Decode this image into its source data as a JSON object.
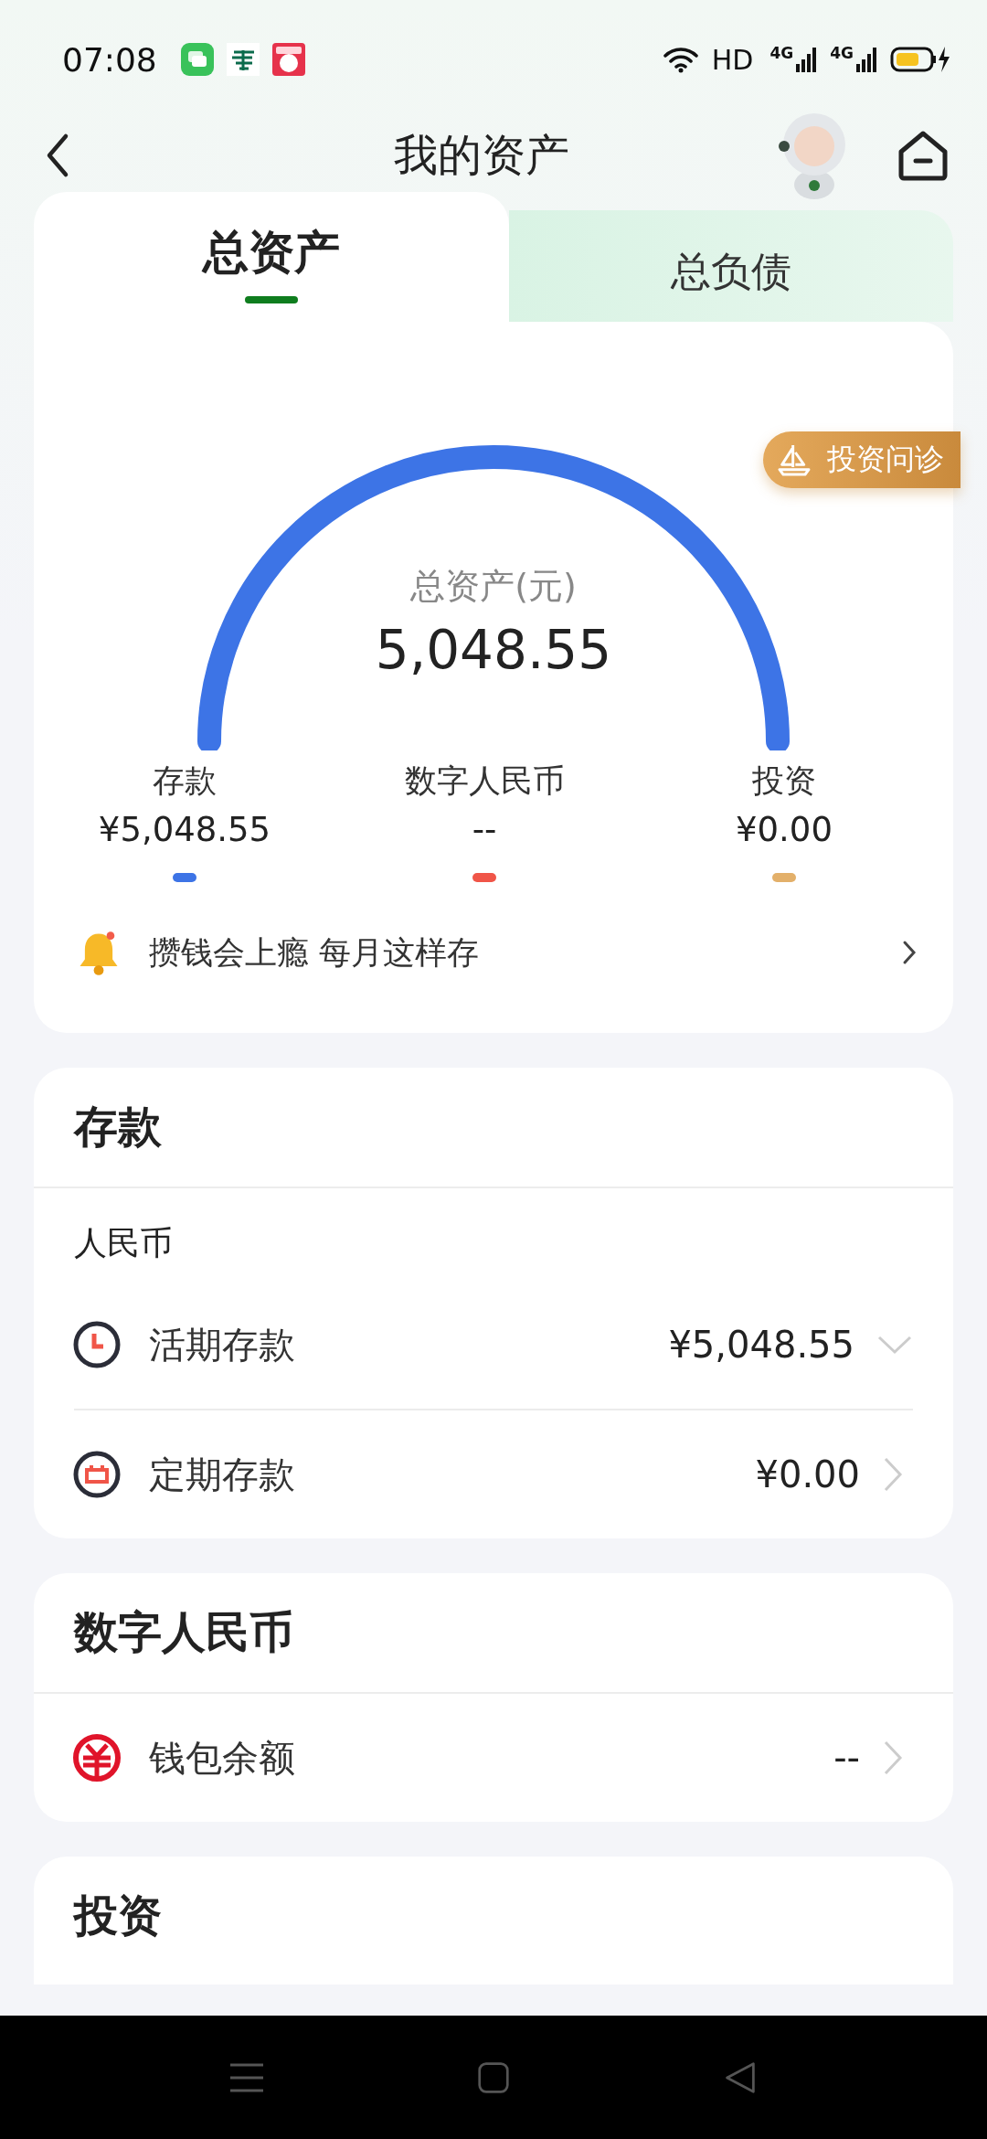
{
  "status_bar": {
    "time": "07:08",
    "hd": "HD",
    "network": [
      "4G",
      "4G"
    ]
  },
  "header": {
    "title": "我的资产"
  },
  "tabs": [
    {
      "label": "总资产",
      "selected": true
    },
    {
      "label": "总负债",
      "selected": false
    }
  ],
  "summary": {
    "badge": "投资问诊",
    "caption": "总资产(元)",
    "total": "5,048.55",
    "legend": [
      {
        "label": "存款",
        "value": "¥5,048.55",
        "color": "#3d74e6"
      },
      {
        "label": "数字人民币",
        "value": "--",
        "color": "#f05548"
      },
      {
        "label": "投资",
        "value": "¥0.00",
        "color": "#e3b06a"
      }
    ],
    "promo": "攒钱会上瘾 每月这样存"
  },
  "sections": [
    {
      "title": "存款",
      "subtitle": "人民币",
      "rows": [
        {
          "label": "活期存款",
          "value": "¥5,048.55",
          "kind": "expand"
        },
        {
          "label": "定期存款",
          "value": "¥0.00",
          "kind": "link"
        }
      ]
    },
    {
      "title": "数字人民币",
      "rows": [
        {
          "label": "钱包余额",
          "value": "--",
          "kind": "link"
        }
      ]
    },
    {
      "title": "投资"
    }
  ]
}
